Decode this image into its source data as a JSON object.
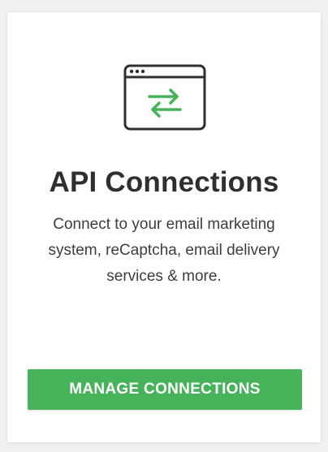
{
  "card": {
    "icon": "browser-window-arrows-icon",
    "title": "API Connections",
    "description": "Connect to your email marketing system, reCaptcha, email delivery services & more.",
    "button_label": "MANAGE CONNECTIONS"
  },
  "colors": {
    "accent_green": "#46b25a",
    "icon_stroke": "#2f2f2f",
    "title_text": "#2f2f2f",
    "body_text": "#3d3d3d",
    "card_bg": "#ffffff",
    "page_bg": "#f1f1f1"
  }
}
